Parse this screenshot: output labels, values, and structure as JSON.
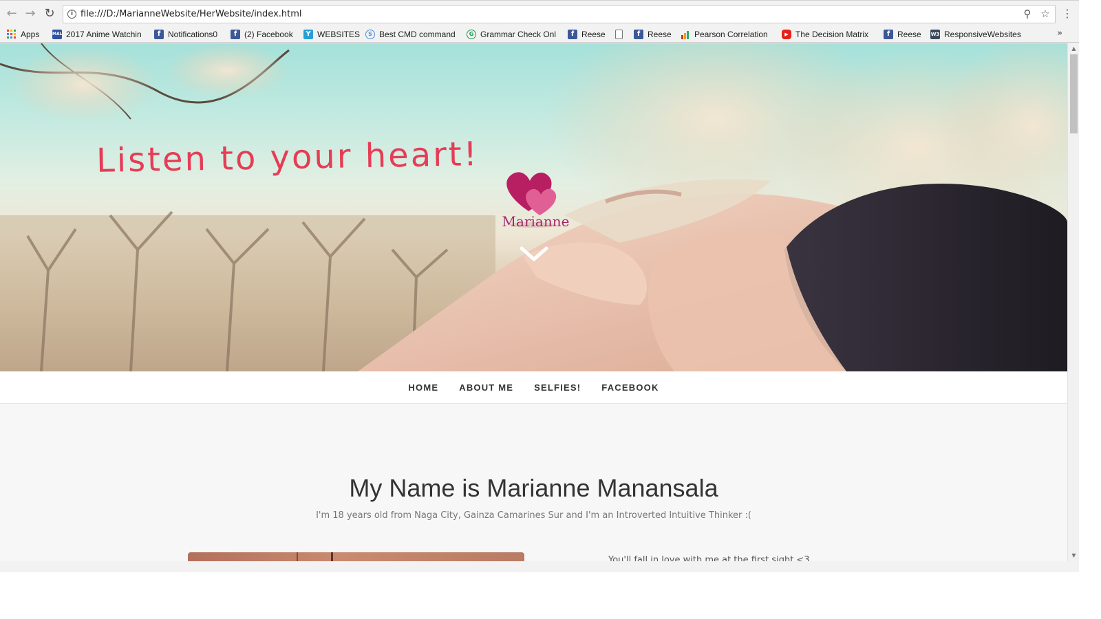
{
  "browser": {
    "url": "file:///D:/MarianneWebsite/HerWebsite/index.html",
    "bookmarks": [
      {
        "label": "Apps",
        "icon": "apps-grid-icon",
        "color": "#e94335"
      },
      {
        "label": "2017 Anime Watchin",
        "icon": "mal-icon",
        "color": "#2e51a2"
      },
      {
        "label": "Notifications0",
        "icon": "facebook-icon",
        "color": "#3b5998"
      },
      {
        "label": "(2) Facebook",
        "icon": "facebook-icon",
        "color": "#3b5998"
      },
      {
        "label": "WEBSITES",
        "icon": "bookmark-y-icon",
        "color": "#2a9fd6"
      },
      {
        "label": "Best CMD command",
        "icon": "globe-icon",
        "color": "#4a90d9"
      },
      {
        "label": "Grammar Check Onl",
        "icon": "grammar-icon",
        "color": "#15a04a"
      },
      {
        "label": "Reese",
        "icon": "facebook-icon",
        "color": "#3b5998"
      },
      {
        "label": "",
        "icon": "page-icon",
        "color": "#ffffff"
      },
      {
        "label": "Reese",
        "icon": "facebook-icon",
        "color": "#3b5998"
      },
      {
        "label": "Pearson Correlation",
        "icon": "bar-chart-icon",
        "color": "#6b8e23"
      },
      {
        "label": "The Decision Matrix",
        "icon": "youtube-icon",
        "color": "#e62117"
      },
      {
        "label": "Reese",
        "icon": "facebook-icon",
        "color": "#3b5998"
      },
      {
        "label": "ResponsiveWebsites",
        "icon": "w3-icon",
        "color": "#3a4a5c"
      }
    ]
  },
  "hero": {
    "tagline": "Listen to your heart!",
    "logo_name": "Marianne"
  },
  "nav": {
    "items": [
      "HOME",
      "ABOUT ME",
      "SELFIES!",
      "FACEBOOK"
    ]
  },
  "main": {
    "title": "My Name is Marianne Manansala",
    "subtitle": "I'm 18 years old from Naga City, Gainza Camarines Sur and I'm an Introverted Intuitive Thinker :(",
    "side_text": "You'll fall in love with me at the first sight <3"
  }
}
